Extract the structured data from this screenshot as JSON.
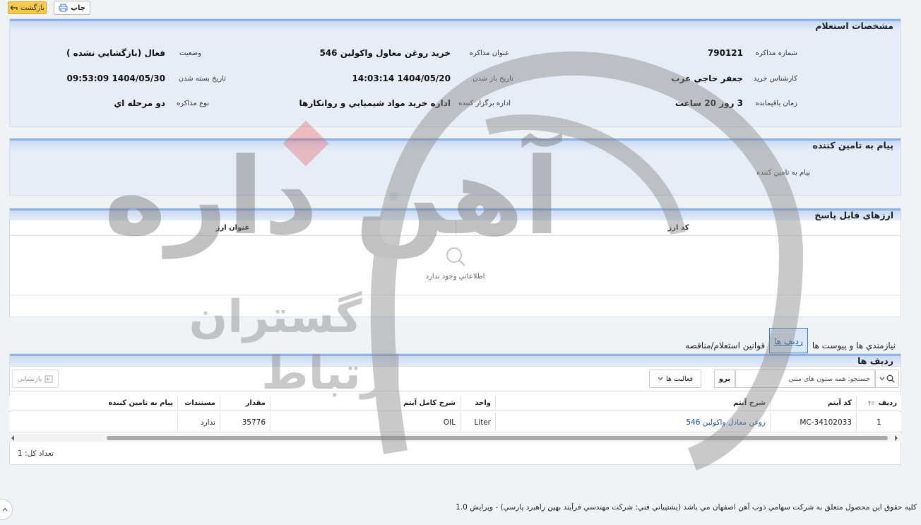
{
  "toolbar_top": {
    "back_label": "بازگشت",
    "print_label": "چاپ"
  },
  "section1": {
    "title": "مشخصات استعلام",
    "fields": {
      "tender_no_label": "شماره مذاكره",
      "tender_no_value": "790121",
      "title_label": "عنوان مذاكره",
      "title_value": "خريد روغن معاول واكولين 546",
      "status_label": "وضعيت",
      "status_value": "فعال (بازگشايي نشده )",
      "buyer_label": "كارشناس خريد",
      "buyer_value": "جعفر حاجي عرب",
      "open_label": "تاريخ باز شدن",
      "open_value": "1404/05/20 14:03:14",
      "close_label": "تاريخ بسته شدن",
      "close_value": "1404/05/30 09:53:09",
      "remaining_label": "زمان باقيمانده",
      "remaining_value": "3 روز 20 ساعت",
      "dept_label": "اداره برگزار كننده",
      "dept_value": "اداره خريد مواد شيميايي و روانكارها",
      "type_label": "نوع مذاكره",
      "type_value": "دو مرحله اي"
    }
  },
  "section2": {
    "title": "پيام به تامين كننده",
    "field_label": "پيام به تامين كننده"
  },
  "section3": {
    "title": "ارزهاي قابل پاسخ",
    "col_code": "كد ارز",
    "col_name": "عنوان ارز",
    "empty_text": "اطلاعاتي وجود ندارد"
  },
  "tabs": [
    "رديف ها",
    "قوانين استعلام/مناقصه",
    "نيازمندي ها و پيوست ها"
  ],
  "section4": {
    "title": "رديف ها",
    "search_placeholder": "جستجو: همه ستون هاي متني",
    "search_button": "برو",
    "actions_label": "فعاليت ها",
    "reset_label": "بازنشاني",
    "columns": [
      "رديف",
      "كد آيتم",
      "شرح آيتم",
      "واحد",
      "شرح كامل آيتم",
      "مقدار",
      "مستندات",
      "پيام به تامين كننده"
    ],
    "rows": [
      {
        "row": "1",
        "code": "MC-34102033",
        "desc": "روغن معادل واكولين 546",
        "unit": "Liter",
        "full_desc": "OIL",
        "qty": "35776",
        "docs": "ندارد",
        "msg": ""
      }
    ],
    "total_label": "تعداد كل: 1"
  },
  "footer": "كليه حقوق اين محصول متعلق به شركت سهامي ذوب آهن اصفهان مي باشد (پشتيباني فني: شركت مهندسي فرآيند بهين راهبرد پارسي) - ويرايش 1.0",
  "watermark": {
    "logo_main": "آهن داره",
    "logo_sub1": "گستران",
    "logo_sub2": "ارتباط"
  },
  "colors": {
    "accent": "#3a78c9",
    "header_band": "#8eb3e6",
    "back_button": "#f7c94a",
    "link": "#1a56a6"
  }
}
